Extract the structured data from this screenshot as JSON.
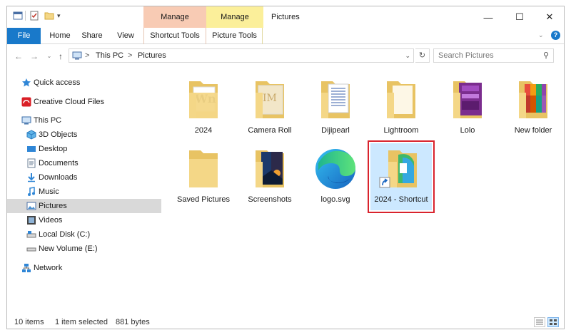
{
  "window": {
    "title": "Pictures",
    "context_tabs": [
      {
        "label": "Manage",
        "color": "#f8cbb4"
      },
      {
        "label": "Manage",
        "color": "#fbef9a"
      }
    ],
    "controls": {
      "minimize": "—",
      "maximize": "☐",
      "close": "✕"
    }
  },
  "ribbon": {
    "tabs": [
      "File",
      "Home",
      "Share",
      "View",
      "Shortcut Tools",
      "Picture Tools"
    ],
    "expand_icon": "chevron-down-icon",
    "help_icon": "help-icon"
  },
  "address": {
    "crumbs": [
      "This PC",
      "Pictures"
    ],
    "separator": ">",
    "search_placeholder": "Search Pictures"
  },
  "nav": {
    "items": [
      {
        "label": "Quick access",
        "icon": "star-icon"
      },
      {
        "label": "Creative Cloud Files",
        "icon": "creative-cloud-icon"
      },
      {
        "label": "This PC",
        "icon": "computer-icon"
      },
      {
        "label": "3D Objects",
        "icon": "cube-icon"
      },
      {
        "label": "Desktop",
        "icon": "desktop-icon"
      },
      {
        "label": "Documents",
        "icon": "documents-icon"
      },
      {
        "label": "Downloads",
        "icon": "download-icon"
      },
      {
        "label": "Music",
        "icon": "music-icon"
      },
      {
        "label": "Pictures",
        "icon": "pictures-icon",
        "selected": true
      },
      {
        "label": "Videos",
        "icon": "videos-icon"
      },
      {
        "label": "Local Disk (C:)",
        "icon": "drive-icon"
      },
      {
        "label": "New Volume (E:)",
        "icon": "drive-icon"
      },
      {
        "label": "Network",
        "icon": "network-icon"
      }
    ]
  },
  "files": [
    {
      "label": "2024",
      "icon": "folder-icon"
    },
    {
      "label": "Camera Roll",
      "icon": "folder-icon"
    },
    {
      "label": "Dijipearl",
      "icon": "folder-icon"
    },
    {
      "label": "Lightroom",
      "icon": "folder-icon"
    },
    {
      "label": "Lolo",
      "icon": "folder-icon"
    },
    {
      "label": "New folder",
      "icon": "folder-icon"
    },
    {
      "label": "Saved Pictures",
      "icon": "folder-icon"
    },
    {
      "label": "Screenshots",
      "icon": "folder-icon"
    },
    {
      "label": "logo.svg",
      "icon": "edge-icon"
    },
    {
      "label": "2024 - Shortcut",
      "icon": "shortcut-icon",
      "selected": true
    }
  ],
  "status": {
    "items_count": "10 items",
    "selection": "1 item selected",
    "size": "881 bytes"
  },
  "colors": {
    "accent": "#1979ca",
    "selection": "#cce8ff",
    "highlight": "#d9232d",
    "folder": "#f4d787"
  }
}
